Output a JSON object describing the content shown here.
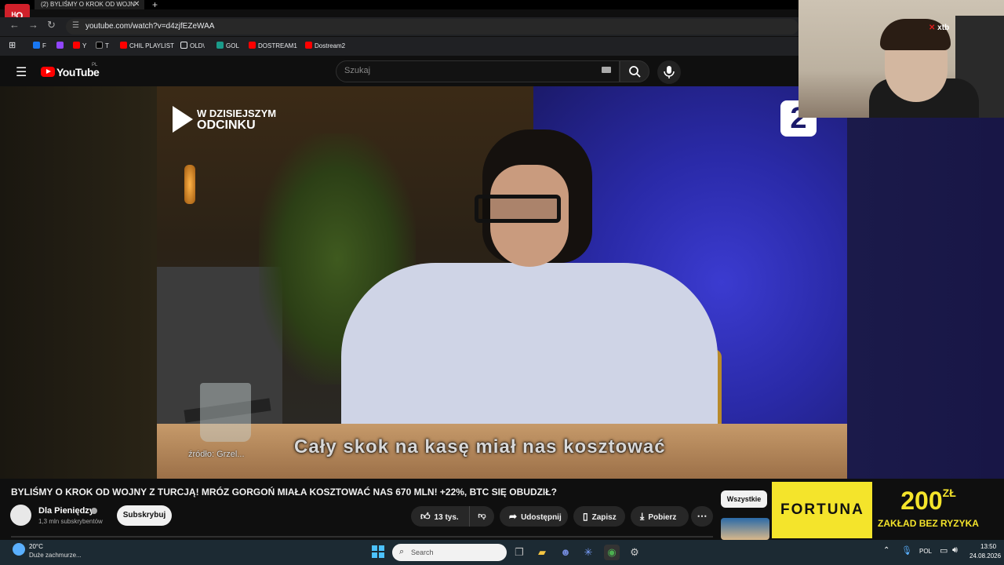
{
  "browser": {
    "tab_title": "(2) BYLIŚMY O KROK OD WOJN",
    "url": "youtube.com/watch?v=d4zjfEZeWAA",
    "bookmarks": [
      {
        "label": "F",
        "color": "#1877f2"
      },
      {
        "label": "",
        "color": "#9146ff"
      },
      {
        "label": "Y",
        "color": "#ff0000"
      },
      {
        "label": "T",
        "color": "#000000"
      },
      {
        "label": "CHIL PLAYLIST",
        "color": "#ff0000"
      },
      {
        "label": "OLD\\",
        "color": "#e8eaed"
      },
      {
        "label": "GOL",
        "color": "#1a9b8a"
      },
      {
        "label": "DOSTREAM1",
        "color": "#ff0000"
      },
      {
        "label": "Dostream2",
        "color": "#ff0000"
      }
    ]
  },
  "header": {
    "logo_text": "YouTube",
    "logo_region": "PL",
    "search_placeholder": "Szukaj"
  },
  "video": {
    "episode_line1": "W DZISIEJSZYM",
    "episode_line2": "ODCINKU",
    "channel_logo": "2",
    "subtitle": "Cały skok na kasę miał nas kosztować",
    "source_label": "źródło: Grzel..."
  },
  "info": {
    "title": "BYLIŚMY O KROK OD WOJNY Z TURCJĄ! MRÓZ GORGOŃ MIAŁA KOSZTOWAĆ NAS 670 MLN! +22%, BTC SIĘ OBUDZIŁ?",
    "channel_name": "Dla Pieniędzy",
    "subscribers": "1,3 mln subskrybentów",
    "subscribe_label": "Subskrybuj",
    "like_count": "13 tys.",
    "share_label": "Udostępnij",
    "save_label": "Zapisz",
    "download_label": "Pobierz"
  },
  "sidebar": {
    "chip_all": "Wszystkie"
  },
  "ad": {
    "brand": "FORTUNA",
    "amount": "200",
    "amount_unit": "ZŁ",
    "tagline": "ZAKŁAD BEZ RYZYKA"
  },
  "overlay": {
    "sponsor": "xtb",
    "stream_logo": "ᴴO"
  },
  "taskbar": {
    "temperature": "20°C",
    "weather": "Duże zachmurze...",
    "search_label": "Search",
    "language": "POL",
    "time": "13:50",
    "date": "24.08.2026"
  }
}
